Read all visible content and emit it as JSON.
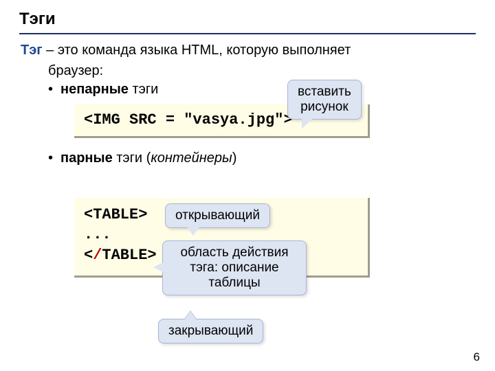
{
  "title": "Тэги",
  "definition": {
    "term": "Тэг",
    "rest_line1": " – это команда языка HTML, которую выполняет",
    "line2": "браузер:"
  },
  "bullets": {
    "nonpaired_bold": "непарные",
    "nonpaired_rest": " тэги",
    "paired_bold": "парные",
    "paired_rest": " тэги (",
    "paired_italic": "контейнеры",
    "paired_close": ")"
  },
  "code1": "<IMG SRC = \"vasya.jpg\">",
  "code2": {
    "open": "<TABLE>",
    "dots": "...",
    "close_pre": "<",
    "close_slash": "/",
    "close_post": "TABLE>"
  },
  "callouts": {
    "insert_image_l1": "вставить",
    "insert_image_l2": "рисунок",
    "opening": "открывающий",
    "scope_l1": "область действия",
    "scope_l2": "тэга: описание",
    "scope_l3": "таблицы",
    "closing": "закрывающий"
  },
  "page_number": "6"
}
